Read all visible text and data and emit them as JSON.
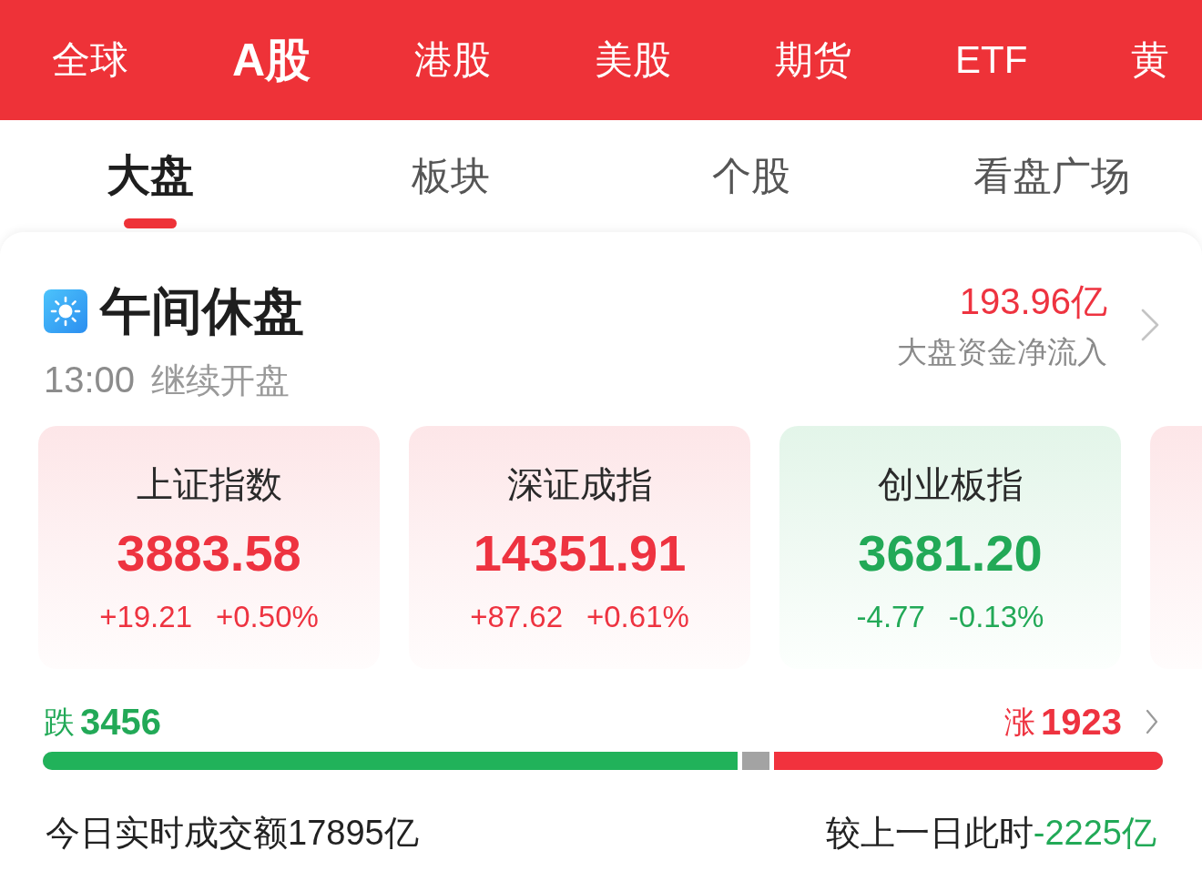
{
  "market_tabs": [
    {
      "label": "全球",
      "selected": false
    },
    {
      "label": "A股",
      "selected": true
    },
    {
      "label": "港股",
      "selected": false
    },
    {
      "label": "美股",
      "selected": false
    },
    {
      "label": "期货",
      "selected": false
    },
    {
      "label": "ETF",
      "selected": false
    },
    {
      "label": "黄",
      "selected": false
    }
  ],
  "view_tabs": [
    {
      "label": "大盘",
      "selected": true
    },
    {
      "label": "板块",
      "selected": false
    },
    {
      "label": "个股",
      "selected": false
    },
    {
      "label": "看盘广场",
      "selected": false
    }
  ],
  "session": {
    "title": "午间休盘",
    "resume_time": "13:00",
    "resume_note": "继续开盘",
    "net_inflow": "193.96亿",
    "net_inflow_label": "大盘资金净流入",
    "net_inflow_rising": true
  },
  "indices": [
    {
      "name": "上证指数",
      "value": "3883.58",
      "change": "+19.21",
      "change_pct": "+0.50%",
      "rising": true
    },
    {
      "name": "深证成指",
      "value": "14351.91",
      "change": "+87.62",
      "change_pct": "+0.61%",
      "rising": true
    },
    {
      "name": "创业板指",
      "value": "3681.20",
      "change": "-4.77",
      "change_pct": "-0.13%",
      "rising": false
    },
    {
      "rising": true
    }
  ],
  "breadth": {
    "down_label": "跌",
    "down_count": "3456",
    "up_label": "涨",
    "up_count": "1923",
    "decline_bar": {
      "level": 0.62
    },
    "advance_bar": {
      "level": 0.347
    }
  },
  "turnover": {
    "label": "今日实时成交额17895亿",
    "compare_label": "较上一日此时",
    "compare_value": "-2225亿",
    "compare_rising": false
  }
}
